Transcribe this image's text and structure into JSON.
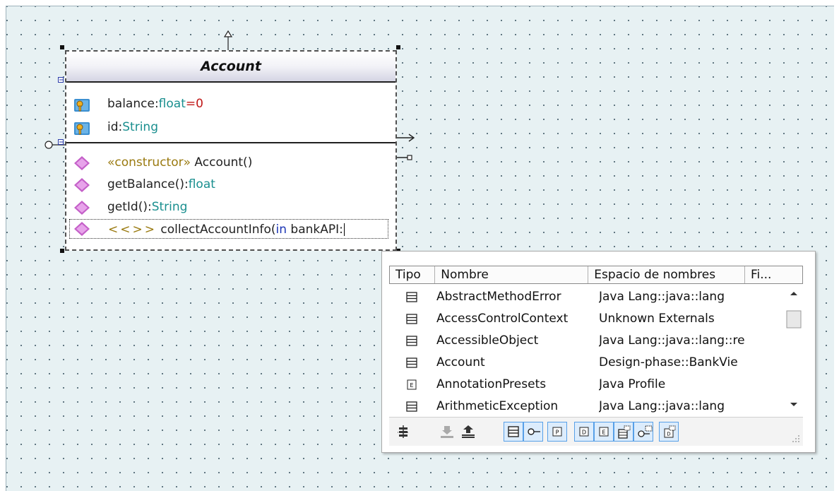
{
  "class_box": {
    "name": "Account",
    "attributes": [
      {
        "name": "balance",
        "sep": ":",
        "type": "float",
        "default": "=0",
        "icon": "private-attribute-key-icon"
      },
      {
        "name": "id",
        "sep": ":",
        "type": "String",
        "icon": "private-attribute-key-icon"
      }
    ],
    "operations": [
      {
        "stereotype": "«constructor»",
        "name": " Account()",
        "icon": "public-operation-diamond-icon"
      },
      {
        "name": "getBalance():",
        "type": "float",
        "icon": "public-operation-diamond-icon"
      },
      {
        "name": "getId():",
        "type": "String",
        "icon": "public-operation-diamond-icon"
      }
    ],
    "editing_operation": {
      "stereotype": "<<>>",
      "name": " collectAccountInfo(",
      "direction": "in",
      "param": " bankAPI:"
    }
  },
  "popup": {
    "columns": [
      "Tipo",
      "Nombre",
      "Espacio de nombres",
      "Fi..."
    ],
    "rows": [
      {
        "kind": "class",
        "icon": "class-icon",
        "name": "AbstractMethodError",
        "namespace": "Java Lang::java::lang"
      },
      {
        "kind": "class",
        "icon": "class-icon",
        "name": "AccessControlContext",
        "namespace": "Unknown Externals"
      },
      {
        "kind": "class",
        "icon": "class-icon",
        "name": "AccessibleObject",
        "namespace": "Java Lang::java::lang::re"
      },
      {
        "kind": "class",
        "icon": "class-icon",
        "name": "Account",
        "namespace": "Design-phase::BankVie"
      },
      {
        "kind": "enumeration",
        "icon": "enumeration-icon",
        "name": "AnnotationPresets",
        "namespace": "Java Profile"
      },
      {
        "kind": "class",
        "icon": "class-icon",
        "name": "ArithmeticException",
        "namespace": "Java Lang::java::lang"
      }
    ],
    "toolbar": [
      {
        "icon": "tree-view-icon",
        "selected": false
      },
      {
        "icon": "sort-descending-icon",
        "selected": false
      },
      {
        "icon": "sort-ascending-icon",
        "selected": false
      },
      {
        "icon": "filter-class-icon",
        "selected": true,
        "glyph": ""
      },
      {
        "icon": "filter-interface-icon",
        "selected": true,
        "glyph": ""
      },
      {
        "icon": "filter-primitive-icon",
        "selected": true,
        "glyph": "P"
      },
      {
        "icon": "filter-datatype-icon",
        "selected": true,
        "glyph": "D"
      },
      {
        "icon": "filter-enumeration-icon",
        "selected": true,
        "glyph": "E"
      },
      {
        "icon": "filter-template-class-icon",
        "selected": true,
        "glyph": ""
      },
      {
        "icon": "filter-template-interface-icon",
        "selected": true,
        "glyph": ""
      },
      {
        "icon": "filter-template-datatype-icon",
        "selected": true,
        "glyph": ""
      }
    ]
  },
  "colors": {
    "canvas_bg": "#e7f1f3",
    "type_color": "#1a8f8f",
    "default_value_color": "#c01818",
    "stereotype_color": "#9a7a10",
    "direction_keyword_color": "#1b35b5",
    "toolbar_selected": "#dcecfc"
  }
}
